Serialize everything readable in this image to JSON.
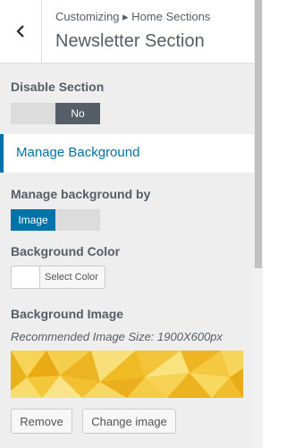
{
  "header": {
    "breadcrumb": "Customizing ▸ Home Sections",
    "title": "Newsletter Section"
  },
  "disable_section": {
    "label": "Disable Section",
    "value": "No"
  },
  "manage_background": {
    "label": "Manage Background"
  },
  "manage_by": {
    "label": "Manage background by",
    "value": "Image"
  },
  "background_color": {
    "label": "Background Color",
    "button": "Select Color",
    "value": "#ffffff"
  },
  "background_image": {
    "label": "Background Image",
    "description": "Recommended Image Size: 1900X600px",
    "remove_label": "Remove",
    "change_label": "Change image"
  },
  "colors": {
    "accent": "#0073aa",
    "toggle_dark": "#555d66",
    "image_yellow": "#f5c518"
  }
}
